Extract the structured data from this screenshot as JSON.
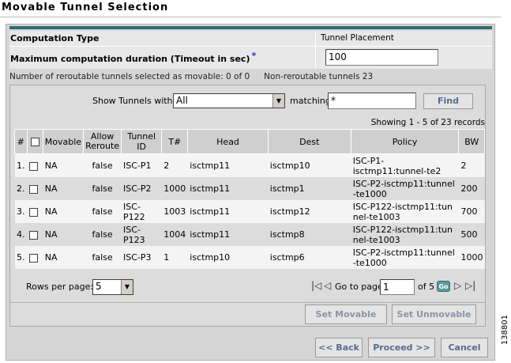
{
  "page": {
    "title": "Movable Tunnel Selection",
    "figure_id": "138801"
  },
  "form": {
    "computation_type_label": "Computation Type",
    "computation_type_value": "Tunnel Placement",
    "max_duration_label": "Maximum computation duration (Timeout in sec)",
    "required_marker": "*",
    "max_duration_value": "100",
    "reroutable_info": "Number of reroutable tunnels selected as movable: 0 of 0",
    "nonreroutable_info": "Non-reroutable tunnels 23"
  },
  "filter": {
    "show_label": "Show Tunnels with",
    "show_value": "All",
    "matching_label": "matching",
    "matching_value": "*",
    "find_label": "Find"
  },
  "table": {
    "showing_text": "Showing 1 - 5 of 23 records",
    "headers": [
      "#",
      "",
      "Movable",
      "Allow Reroute",
      "Tunnel ID",
      "T#",
      "Head",
      "Dest",
      "Policy",
      "BW"
    ],
    "rows": [
      {
        "num": "1.",
        "movable": "NA",
        "allow": "false",
        "tid": "ISC-P1",
        "t": "2",
        "head": "isctmp11",
        "dest": "isctmp10",
        "policy": "ISC-P1-isctmp11:tunnel-te2",
        "bw": "2"
      },
      {
        "num": "2.",
        "movable": "NA",
        "allow": "false",
        "tid": "ISC-P2",
        "t": "1000",
        "head": "isctmp11",
        "dest": "isctmp1",
        "policy": "ISC-P2-isctmp11:tunnel-te1000",
        "bw": "200"
      },
      {
        "num": "3.",
        "movable": "NA",
        "allow": "false",
        "tid": "ISC-P122",
        "t": "1003",
        "head": "isctmp11",
        "dest": "isctmp12",
        "policy": "ISC-P122-isctmp11:tunnel-te1003",
        "bw": "700"
      },
      {
        "num": "4.",
        "movable": "NA",
        "allow": "false",
        "tid": "ISC-P123",
        "t": "1004",
        "head": "isctmp11",
        "dest": "isctmp8",
        "policy": "ISC-P122-isctmp11:tunnel-te1003",
        "bw": "500"
      },
      {
        "num": "5.",
        "movable": "NA",
        "allow": "false",
        "tid": "ISC-P3",
        "t": "1",
        "head": "isctmp10",
        "dest": "isctmp6",
        "policy": "ISC-P2-isctmp11:tunnel-te1000",
        "bw": "1000"
      }
    ]
  },
  "pager": {
    "rows_per_page_label": "Rows per page:",
    "rows_per_page_value": "5",
    "go_to_label": "Go to page:",
    "page_value": "1",
    "of_text": "of 5",
    "go_label": "Go"
  },
  "actions": {
    "set_movable": "Set Movable",
    "set_unmovable": "Set Unmovable",
    "back": "<< Back",
    "proceed": "Proceed >>",
    "cancel": "Cancel"
  }
}
